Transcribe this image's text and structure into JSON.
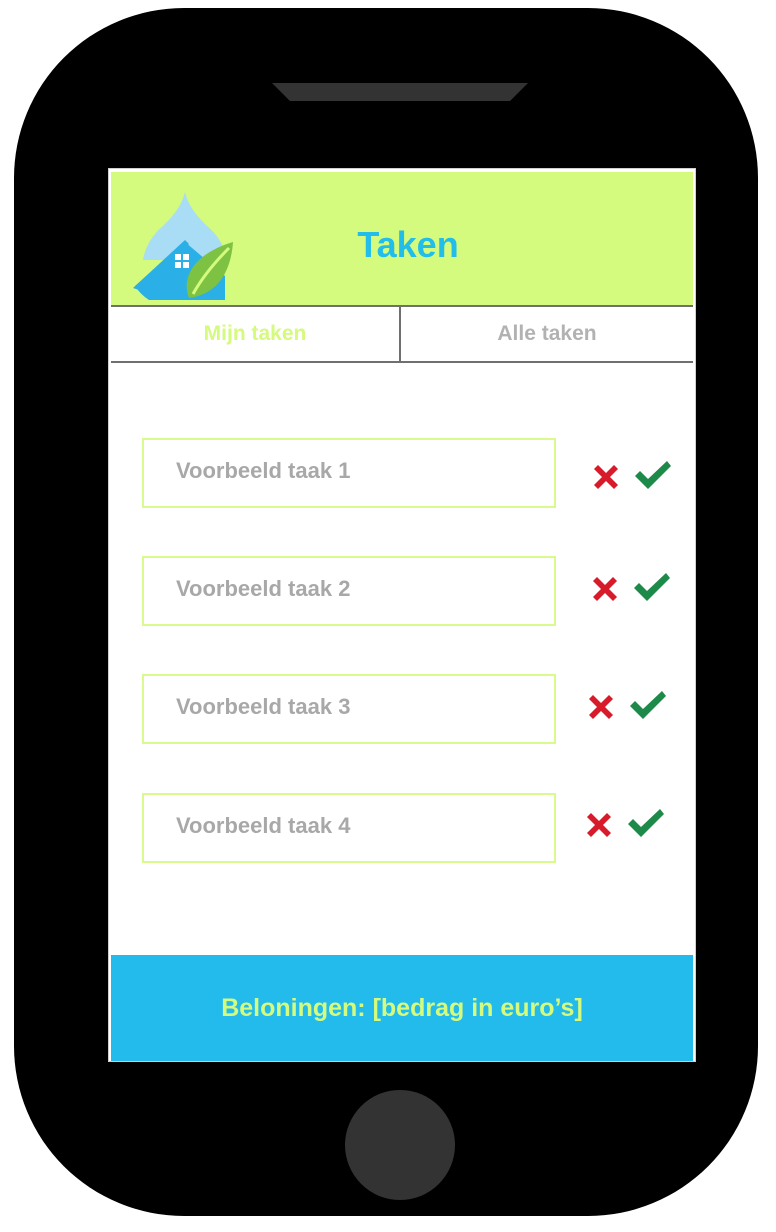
{
  "app": {
    "title": "Taken",
    "colors": {
      "header_bg": "#d4fa7e",
      "accent_blue": "#22bde9",
      "footer_bg": "#22bbec",
      "reject_red": "#d81b2b",
      "accept_green": "#1e8a4a"
    }
  },
  "tabs": [
    {
      "label": "Mijn taken",
      "active": true
    },
    {
      "label": "Alle taken",
      "active": false
    }
  ],
  "tasks": [
    {
      "label": "Voorbeeld taak 1",
      "reject_icon": "x-icon",
      "accept_icon": "checkmark-icon"
    },
    {
      "label": "Voorbeeld taak 2",
      "reject_icon": "x-icon",
      "accept_icon": "checkmark-icon"
    },
    {
      "label": "Voorbeeld taak 3",
      "reject_icon": "x-icon",
      "accept_icon": "checkmark-icon"
    },
    {
      "label": "Voorbeeld taak 4",
      "reject_icon": "x-icon",
      "accept_icon": "checkmark-icon"
    }
  ],
  "footer": {
    "rewards_text": "Beloningen: [bedrag in euro’s]"
  }
}
